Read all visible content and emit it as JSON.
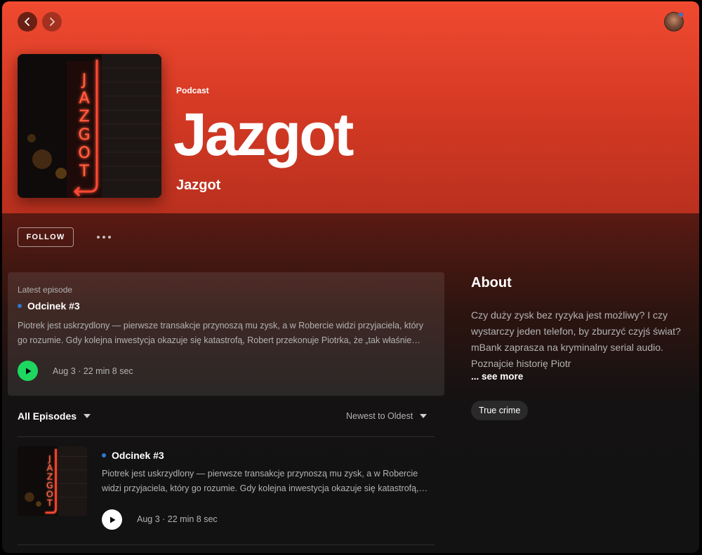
{
  "nav": {
    "back_icon": "chevron-left-icon",
    "forward_icon": "chevron-right-icon"
  },
  "user": {
    "avatar": "user-avatar",
    "notification_color": "#2e77d0"
  },
  "colors": {
    "hero_top": "#f04a30",
    "hero_bottom": "#b9301e",
    "accent_green": "#1ed760",
    "unplayed_dot": "#2e77d0",
    "background": "#121212"
  },
  "podcast": {
    "type_label": "Podcast",
    "title": "Jazgot",
    "publisher": "Jazgot",
    "cover_art_text": "JAZGOT"
  },
  "actions": {
    "follow_label": "FOLLOW",
    "more_icon": "more-options-icon"
  },
  "latest": {
    "label": "Latest episode",
    "episode_title": "Odcinek #3",
    "description": "Piotrek jest uskrzydlony — pierwsze transakcje przynoszą mu zysk, a w Robercie widzi przyjaciela, który go rozumie. Gdy kolejna inwestycja okazuje się katastrofą, Robert przekonuje Piotrka, że „tak właśnie…",
    "meta": "Aug 3 · 22 min 8 sec"
  },
  "episodes_header": {
    "filter_label": "All Episodes",
    "sort_label": "Newest to Oldest"
  },
  "episodes": [
    {
      "title": "Odcinek #3",
      "description": "Piotrek jest uskrzydlony — pierwsze transakcje przynoszą mu zysk, a w Robercie widzi przyjaciela, który go rozumie. Gdy kolejna inwestycja okazuje się katastrofą,…",
      "meta": "Aug 3 · 22 min 8 sec"
    }
  ],
  "about": {
    "title": "About",
    "text": "Czy duży zysk bez ryzyka jest możliwy? I czy wystarczy jeden telefon, by zburzyć czyjś świat? mBank zaprasza na kryminalny serial audio. Poznajcie historię Piotr",
    "see_more": "... see more",
    "tags": [
      "True crime"
    ]
  }
}
